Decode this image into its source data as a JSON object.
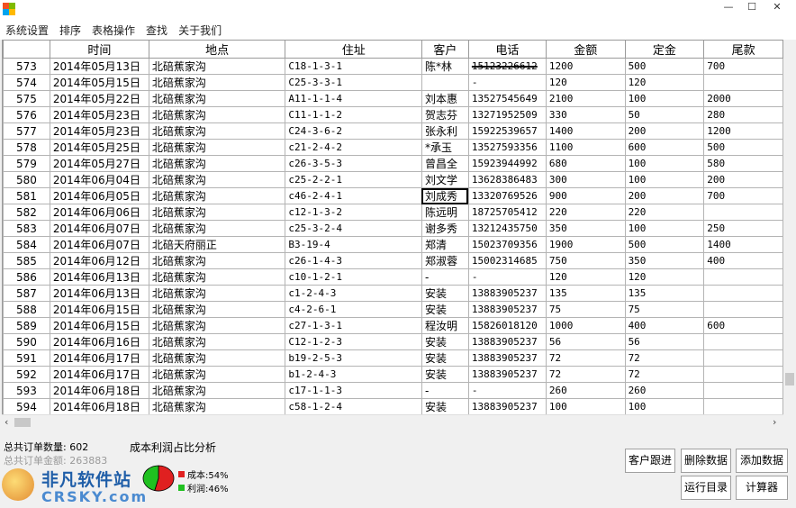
{
  "menu": [
    "系统设置",
    "排序",
    "表格操作",
    "查找",
    "关于我们"
  ],
  "window_buttons": {
    "minimize": "—",
    "maximize": "☐",
    "close": "✕"
  },
  "columns": [
    "",
    "时间",
    "地点",
    "住址",
    "客户",
    "电话",
    "金额",
    "定金",
    "尾款"
  ],
  "rows": [
    {
      "idx": "573",
      "date": "2014年05月13日",
      "place": "北碚蕉家沟",
      "addr": "C18-1-3-1",
      "cust": "陈*林",
      "phone": "15123226612",
      "amount": "1200",
      "deposit": "500",
      "balance": "700",
      "phone_struck": true
    },
    {
      "idx": "574",
      "date": "2014年05月15日",
      "place": "北碚蕉家沟",
      "addr": "C25-3-3-1",
      "cust": "",
      "phone": "-",
      "amount": "120",
      "deposit": "120",
      "balance": ""
    },
    {
      "idx": "575",
      "date": "2014年05月22日",
      "place": "北碚蕉家沟",
      "addr": "A11-1-1-4",
      "cust": "刘本惠",
      "phone": "13527545649",
      "amount": "2100",
      "deposit": "100",
      "balance": "2000"
    },
    {
      "idx": "576",
      "date": "2014年05月23日",
      "place": "北碚蕉家沟",
      "addr": "C11-1-1-2",
      "cust": "贺志芬",
      "phone": "13271952509",
      "amount": "330",
      "deposit": "50",
      "balance": "280"
    },
    {
      "idx": "577",
      "date": "2014年05月23日",
      "place": "北碚蕉家沟",
      "addr": "C24-3-6-2",
      "cust": "张永利",
      "phone": "15922539657",
      "amount": "1400",
      "deposit": "200",
      "balance": "1200"
    },
    {
      "idx": "578",
      "date": "2014年05月25日",
      "place": "北碚蕉家沟",
      "addr": "c21-2-4-2",
      "cust": "*承玉",
      "phone": "13527593356",
      "amount": "1100",
      "deposit": "600",
      "balance": "500"
    },
    {
      "idx": "579",
      "date": "2014年05月27日",
      "place": "北碚蕉家沟",
      "addr": "c26-3-5-3",
      "cust": "曾昌全",
      "phone": "15923944992",
      "amount": "680",
      "deposit": "100",
      "balance": "580"
    },
    {
      "idx": "580",
      "date": "2014年06月04日",
      "place": "北碚蕉家沟",
      "addr": "c25-2-2-1",
      "cust": "刘文学",
      "phone": "13628386483",
      "amount": "300",
      "deposit": "100",
      "balance": "200"
    },
    {
      "idx": "581",
      "date": "2014年06月05日",
      "place": "北碚蕉家沟",
      "addr": "c46-2-4-1",
      "cust": "刘成秀",
      "phone": "13320769526",
      "amount": "900",
      "deposit": "200",
      "balance": "700",
      "selected": true
    },
    {
      "idx": "582",
      "date": "2014年06月06日",
      "place": "北碚蕉家沟",
      "addr": "c12-1-3-2",
      "cust": "陈远明",
      "phone": "18725705412",
      "amount": "220",
      "deposit": "220",
      "balance": ""
    },
    {
      "idx": "583",
      "date": "2014年06月07日",
      "place": "北碚蕉家沟",
      "addr": "c25-3-2-4",
      "cust": "谢多秀",
      "phone": "13212435750",
      "amount": "350",
      "deposit": "100",
      "balance": "250"
    },
    {
      "idx": "584",
      "date": "2014年06月07日",
      "place": "北碚天府丽正",
      "addr": "B3-19-4",
      "cust": "郑清",
      "phone": "15023709356",
      "amount": "1900",
      "deposit": "500",
      "balance": "1400"
    },
    {
      "idx": "585",
      "date": "2014年06月12日",
      "place": "北碚蕉家沟",
      "addr": "c26-1-4-3",
      "cust": "郑淑蓉",
      "phone": "15002314685",
      "amount": "750",
      "deposit": "350",
      "balance": "400"
    },
    {
      "idx": "586",
      "date": "2014年06月13日",
      "place": "北碚蕉家沟",
      "addr": "c10-1-2-1",
      "cust": "-",
      "phone": "-",
      "amount": "120",
      "deposit": "120",
      "balance": ""
    },
    {
      "idx": "587",
      "date": "2014年06月13日",
      "place": "北碚蕉家沟",
      "addr": "c1-2-4-3",
      "cust": "安装",
      "phone": "13883905237",
      "amount": "135",
      "deposit": "135",
      "balance": ""
    },
    {
      "idx": "588",
      "date": "2014年06月15日",
      "place": "北碚蕉家沟",
      "addr": "c4-2-6-1",
      "cust": "安装",
      "phone": "13883905237",
      "amount": "75",
      "deposit": "75",
      "balance": ""
    },
    {
      "idx": "589",
      "date": "2014年06月15日",
      "place": "北碚蕉家沟",
      "addr": "c27-1-3-1",
      "cust": "程汝明",
      "phone": "15826018120",
      "amount": "1000",
      "deposit": "400",
      "balance": "600"
    },
    {
      "idx": "590",
      "date": "2014年06月16日",
      "place": "北碚蕉家沟",
      "addr": "C12-1-2-3",
      "cust": "安装",
      "phone": "13883905237",
      "amount": "56",
      "deposit": "56",
      "balance": ""
    },
    {
      "idx": "591",
      "date": "2014年06月17日",
      "place": "北碚蕉家沟",
      "addr": "b19-2-5-3",
      "cust": "安装",
      "phone": "13883905237",
      "amount": "72",
      "deposit": "72",
      "balance": ""
    },
    {
      "idx": "592",
      "date": "2014年06月17日",
      "place": "北碚蕉家沟",
      "addr": "b1-2-4-3",
      "cust": "安装",
      "phone": "13883905237",
      "amount": "72",
      "deposit": "72",
      "balance": ""
    },
    {
      "idx": "593",
      "date": "2014年06月18日",
      "place": "北碚蕉家沟",
      "addr": "c17-1-1-3",
      "cust": "-",
      "phone": "-",
      "amount": "260",
      "deposit": "260",
      "balance": ""
    },
    {
      "idx": "594",
      "date": "2014年06月18日",
      "place": "北碚蕉家沟",
      "addr": "c58-1-2-4",
      "cust": "安装",
      "phone": "13883905237",
      "amount": "100",
      "deposit": "100",
      "balance": ""
    }
  ],
  "stats": {
    "order_count": "总共订单数量: 602",
    "total_amount": "总共订单金额: 263883"
  },
  "analysis": {
    "title": "成本利润占比分析",
    "cost_label": "成本:54%",
    "profit_label": "利润:46%",
    "cost_share": 0.54,
    "profit_share": 0.46,
    "cost_color": "#e02020",
    "profit_color": "#20c020"
  },
  "buttons": {
    "follow": "客户跟进",
    "delete": "删除数据",
    "add": "添加数据",
    "catalog": "运行目录",
    "calculator": "计算器"
  },
  "watermark": {
    "main": "非凡软件站",
    "sub": "CRSKY.com"
  }
}
